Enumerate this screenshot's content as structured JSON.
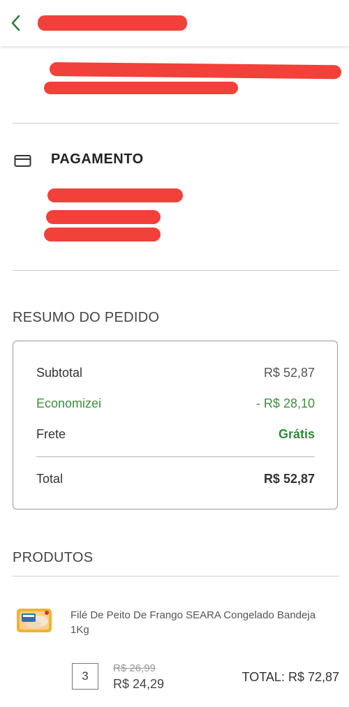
{
  "header": {
    "back_icon": "chevron-left-icon"
  },
  "payment": {
    "icon": "credit-card-icon",
    "title": "PAGAMENTO"
  },
  "summary": {
    "section_title": "RESUMO DO PEDIDO",
    "subtotal_label": "Subtotal",
    "subtotal_value": "R$ 52,87",
    "savings_label": "Economizei",
    "savings_value": "- R$ 28,10",
    "shipping_label": "Frete",
    "shipping_value": "Grátis",
    "total_label": "Total",
    "total_value": "R$ 52,87"
  },
  "products": {
    "section_title": "PRODUTOS",
    "items": [
      {
        "name": "Filé De Peito De Frango SEARA Congelado Bandeja 1Kg",
        "quantity": "3",
        "old_price": "R$ 26,99",
        "price": "R$ 24,29",
        "total": "TOTAL: R$ 72,87"
      }
    ]
  },
  "colors": {
    "accent_green": "#2f8a3a",
    "redaction": "#f1413a"
  }
}
